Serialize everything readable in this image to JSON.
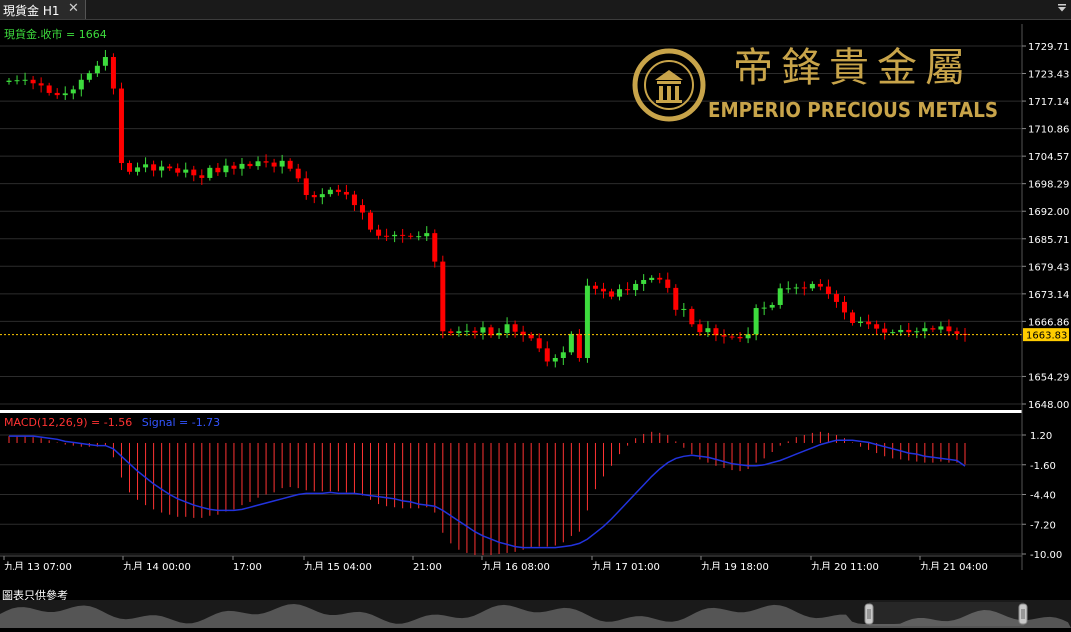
{
  "tab": {
    "title": "現貨金 H1",
    "close": "✕",
    "menu_icon": "dropdown-menu-icon"
  },
  "price_panel": {
    "legend": "現貨金.收市 = 1664",
    "legend_color": "#3ddc3d",
    "current_price": "1663.83",
    "current_color": "#ffcc00",
    "y_ticks": [
      "1729.71",
      "1723.43",
      "1717.14",
      "1710.86",
      "1704.57",
      "1698.29",
      "1692.00",
      "1685.71",
      "1679.43",
      "1673.14",
      "1666.86",
      "1654.29",
      "1648.00"
    ]
  },
  "macd_panel": {
    "legend_macd": "MACD(12,26,9) = -1.56",
    "legend_signal": "Signal = -1.73",
    "macd_color": "#ff3333",
    "signal_color": "#3355ff",
    "y_ticks": [
      "1.20",
      "-1.60",
      "-4.40",
      "-7.20",
      "-10.00"
    ]
  },
  "x_axis": {
    "ticks": [
      "九月 13 07:00",
      "九月 14 00:00",
      "17:00",
      "九月 15 04:00",
      "21:00",
      "九月 16 08:00",
      "九月 17 01:00",
      "九月 19 18:00",
      "九月 20 11:00",
      "九月 21 04:00"
    ]
  },
  "logo": {
    "chinese": "帝鋒貴金屬",
    "english": "EMPERIO PRECIOUS METALS",
    "emblem": "emperio-emblem-icon",
    "gold": "#c8a44a"
  },
  "footer": {
    "label": "圖表只供參考"
  },
  "scrollbar": {
    "handle_icon": "scroll-handle-icon"
  },
  "colors": {
    "up": "#3ddc3d",
    "down": "#ff0000",
    "grid": "#2c2c2c",
    "axis_text": "#ffffff"
  },
  "chart_data": [
    {
      "type": "candlestick",
      "title": "現貨金 H1",
      "series_name": "現貨金",
      "ylim": [
        1648.0,
        1732.0
      ],
      "close": [
        1721.8,
        1721.9,
        1722.0,
        1721.2,
        1720.7,
        1719.0,
        1718.5,
        1718.9,
        1719.8,
        1722.0,
        1723.5,
        1725.2,
        1727.2,
        1720.0,
        1703.0,
        1701.0,
        1702.0,
        1702.7,
        1701.3,
        1702.2,
        1701.8,
        1700.8,
        1701.5,
        1700.2,
        1699.6,
        1701.9,
        1700.9,
        1702.4,
        1701.7,
        1702.8,
        1702.3,
        1703.4,
        1703.1,
        1702.2,
        1703.5,
        1701.7,
        1699.5,
        1695.7,
        1695.2,
        1695.9,
        1696.9,
        1696.4,
        1695.8,
        1693.4,
        1691.7,
        1687.8,
        1686.4,
        1686.3,
        1686.6,
        1686.4,
        1686.2,
        1686.3,
        1687.0,
        1680.5,
        1664.6,
        1664.2,
        1664.6,
        1664.7,
        1664.3,
        1665.5,
        1663.7,
        1664.2,
        1666.2,
        1664.5,
        1663.8,
        1663.0,
        1660.7,
        1657.7,
        1658.5,
        1659.8,
        1664.0,
        1658.5,
        1675.0,
        1674.3,
        1673.7,
        1672.5,
        1674.2,
        1674.0,
        1675.4,
        1676.3,
        1676.8,
        1676.4,
        1674.5,
        1669.5,
        1669.7,
        1666.2,
        1664.4,
        1665.3,
        1663.7,
        1663.4,
        1663.3,
        1663.0,
        1663.9,
        1669.9,
        1670.0,
        1670.6,
        1674.4,
        1674.4,
        1674.6,
        1674.4,
        1675.4,
        1674.8,
        1673.1,
        1671.3,
        1668.9,
        1666.5,
        1666.8,
        1666.2,
        1665.2,
        1664.3,
        1664.4,
        1664.9,
        1664.4,
        1664.6,
        1665.3,
        1665.0,
        1665.7,
        1664.6,
        1664.0,
        1663.8
      ],
      "volume_markers": [],
      "note_axis": "x tick labels shown below; ~118 hourly candles"
    },
    {
      "type": "macd",
      "title": "MACD(12,26,9)",
      "ylim": [
        -11.0,
        2.0
      ],
      "macd": [
        1.1,
        1.1,
        1.1,
        1.0,
        0.9,
        0.7,
        0.5,
        0.3,
        0.2,
        0.1,
        0.1,
        0.1,
        0.2,
        -0.9,
        -2.8,
        -4.2,
        -4.9,
        -5.4,
        -5.8,
        -6.1,
        -6.3,
        -6.5,
        -6.5,
        -6.6,
        -6.6,
        -6.4,
        -6.3,
        -6.0,
        -5.8,
        -5.4,
        -5.1,
        -4.7,
        -4.4,
        -4.2,
        -3.8,
        -3.7,
        -3.8,
        -4.0,
        -4.1,
        -4.1,
        -4.1,
        -4.1,
        -4.2,
        -4.3,
        -4.5,
        -4.9,
        -5.3,
        -5.5,
        -5.6,
        -5.7,
        -5.7,
        -5.7,
        -5.6,
        -6.1,
        -8.0,
        -9.0,
        -9.6,
        -9.9,
        -10.1,
        -10.1,
        -10.1,
        -10.0,
        -9.9,
        -9.8,
        -9.6,
        -9.4,
        -9.3,
        -9.3,
        -9.2,
        -8.9,
        -8.3,
        -7.9,
        -5.9,
        -3.9,
        -2.7,
        -1.7,
        -0.6,
        0.2,
        0.9,
        1.3,
        1.5,
        1.4,
        1.2,
        0.6,
        0.0,
        -0.6,
        -1.1,
        -1.4,
        -1.7,
        -1.9,
        -2.1,
        -2.2,
        -2.0,
        -1.4,
        -1.0,
        -0.4,
        0.2,
        0.6,
        1.0,
        1.2,
        1.4,
        1.5,
        1.4,
        1.2,
        0.9,
        0.5,
        0.1,
        -0.2,
        -0.5,
        -0.8,
        -1.0,
        -1.1,
        -1.2,
        -1.3,
        -1.4,
        -1.4,
        -1.3,
        -1.4,
        -1.4,
        -1.56
      ],
      "signal": [
        1.1,
        1.1,
        1.1,
        1.1,
        1.0,
        0.9,
        0.8,
        0.6,
        0.5,
        0.4,
        0.3,
        0.2,
        0.2,
        -0.1,
        -0.8,
        -1.5,
        -2.2,
        -2.8,
        -3.4,
        -3.9,
        -4.4,
        -4.8,
        -5.1,
        -5.4,
        -5.6,
        -5.8,
        -5.9,
        -5.9,
        -5.9,
        -5.8,
        -5.6,
        -5.4,
        -5.2,
        -5.0,
        -4.8,
        -4.6,
        -4.4,
        -4.3,
        -4.3,
        -4.3,
        -4.2,
        -4.3,
        -4.3,
        -4.3,
        -4.4,
        -4.5,
        -4.6,
        -4.7,
        -4.8,
        -5.0,
        -5.1,
        -5.3,
        -5.4,
        -5.5,
        -5.9,
        -6.4,
        -6.9,
        -7.4,
        -7.9,
        -8.3,
        -8.6,
        -8.9,
        -9.1,
        -9.3,
        -9.4,
        -9.4,
        -9.4,
        -9.4,
        -9.4,
        -9.3,
        -9.2,
        -9.0,
        -8.6,
        -8.0,
        -7.4,
        -6.7,
        -5.9,
        -5.1,
        -4.3,
        -3.5,
        -2.7,
        -2.0,
        -1.4,
        -1.0,
        -0.8,
        -0.7,
        -0.8,
        -0.9,
        -1.1,
        -1.3,
        -1.5,
        -1.6,
        -1.7,
        -1.7,
        -1.6,
        -1.4,
        -1.2,
        -0.9,
        -0.6,
        -0.3,
        0.0,
        0.3,
        0.5,
        0.7,
        0.7,
        0.7,
        0.6,
        0.5,
        0.3,
        0.1,
        -0.1,
        -0.3,
        -0.5,
        -0.6,
        -0.8,
        -0.9,
        -1.0,
        -1.1,
        -1.2,
        -1.73
      ]
    }
  ]
}
